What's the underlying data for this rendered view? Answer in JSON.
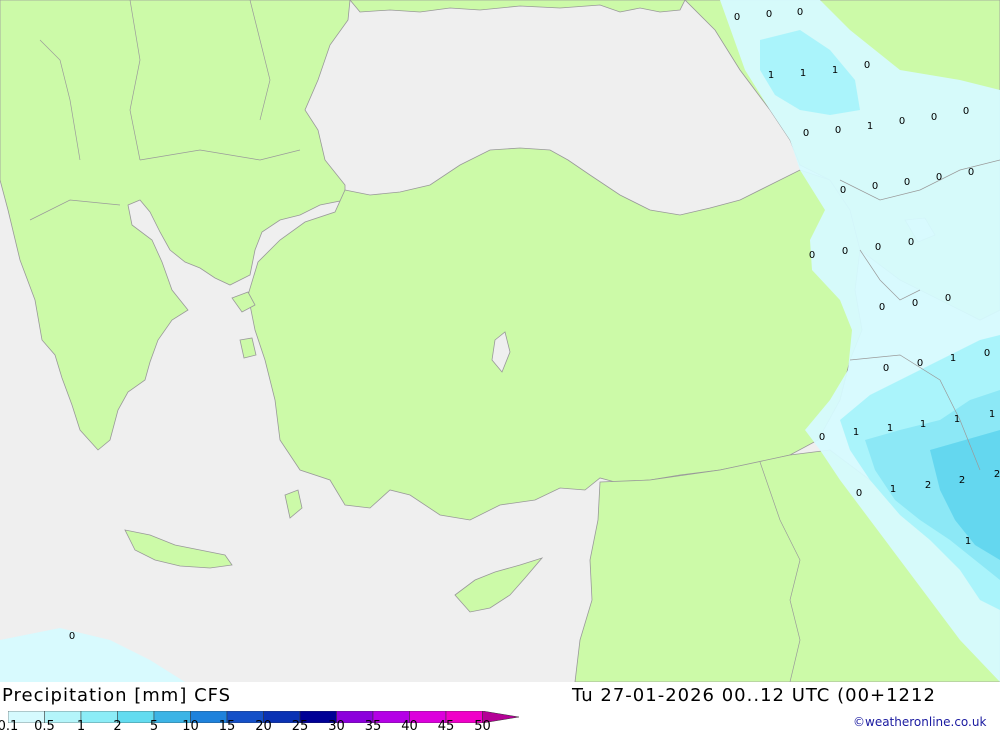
{
  "title": "Precipitation [mm] CFS",
  "datetime": "Tu 27-01-2026 00..12 UTC (00+1212",
  "credit": "©weatheronline.co.uk",
  "legend": {
    "ticks": [
      "0.1",
      "0.5",
      "1",
      "2",
      "5",
      "10",
      "15",
      "20",
      "25",
      "30",
      "35",
      "40",
      "45",
      "50"
    ],
    "colors": [
      "#d6fafe",
      "#b4f5fa",
      "#8cedf7",
      "#63dcf0",
      "#3cb4e6",
      "#1e82dc",
      "#1450c8",
      "#0a32b4",
      "#000096",
      "#8c00dc",
      "#b400e6",
      "#dc00dc",
      "#f000c8",
      "#b40096"
    ]
  },
  "map": {
    "colors": {
      "sea": "#efefef",
      "land": "#ccfaa8",
      "border": "#a0a0a0",
      "precip_light": "#d6fafe",
      "precip_1": "#a8f3fb",
      "precip_2": "#8ae7f5",
      "precip_5": "#62d6ee"
    },
    "values": [
      {
        "text": "0"
      },
      {
        "text": "0"
      },
      {
        "text": "0"
      },
      {
        "text": "1"
      },
      {
        "text": "1"
      },
      {
        "text": "1"
      },
      {
        "text": "0"
      },
      {
        "text": "0"
      },
      {
        "text": "0"
      },
      {
        "text": "1"
      },
      {
        "text": "0"
      },
      {
        "text": "0"
      },
      {
        "text": "0"
      },
      {
        "text": "0"
      },
      {
        "text": "0"
      },
      {
        "text": "0"
      },
      {
        "text": "0"
      },
      {
        "text": "0"
      },
      {
        "text": "0"
      },
      {
        "text": "0"
      },
      {
        "text": "0"
      },
      {
        "text": "0"
      },
      {
        "text": "0"
      },
      {
        "text": "0"
      },
      {
        "text": "0"
      },
      {
        "text": "0"
      },
      {
        "text": "0"
      },
      {
        "text": "1"
      },
      {
        "text": "0"
      },
      {
        "text": "0"
      },
      {
        "text": "1"
      },
      {
        "text": "1"
      },
      {
        "text": "1"
      },
      {
        "text": "1"
      },
      {
        "text": "1"
      },
      {
        "text": "0"
      },
      {
        "text": "1"
      },
      {
        "text": "2"
      },
      {
        "text": "2"
      },
      {
        "text": "2"
      },
      {
        "text": "1"
      },
      {
        "text": "0"
      }
    ]
  }
}
